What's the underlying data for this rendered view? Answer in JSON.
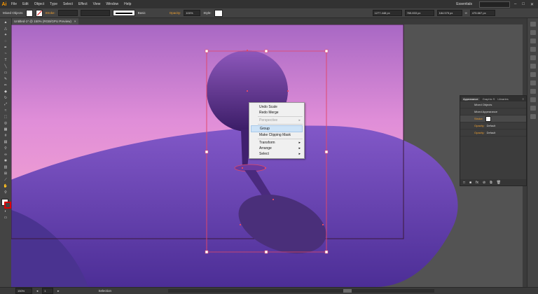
{
  "app": {
    "logo": "Ai"
  },
  "menu": [
    "File",
    "Edit",
    "Object",
    "Type",
    "Select",
    "Effect",
    "View",
    "Window",
    "Help"
  ],
  "workspace": "Essentials",
  "controlbar": {
    "selection_label": "Mixed Objects",
    "stroke_label": "Stroke:",
    "stroke_style": "Basic",
    "opacity_label": "Opacity:",
    "opacity_value": "100%",
    "style_label": "Style:",
    "x_value": "1277.448 px",
    "y_value": "765.833 px",
    "w_value": "184.575 px",
    "h_value": "475.667 px"
  },
  "document_tab": {
    "title": "Untitled-1* @ 150% (RGB/GPU Preview)",
    "close": "×"
  },
  "context_menu": [
    {
      "label": "Undo Scale",
      "enabled": true
    },
    {
      "label": "Redo Merge",
      "enabled": true
    },
    {
      "sep": true
    },
    {
      "label": "Perspective",
      "enabled": false,
      "submenu": true
    },
    {
      "sep": true
    },
    {
      "label": "Group",
      "enabled": true,
      "highlighted": true
    },
    {
      "label": "Make Clipping Mask",
      "enabled": true
    },
    {
      "sep": true
    },
    {
      "label": "Transform",
      "enabled": true,
      "submenu": true
    },
    {
      "label": "Arrange",
      "enabled": true,
      "submenu": true
    },
    {
      "label": "Select",
      "enabled": true,
      "submenu": true
    }
  ],
  "appearance_panel": {
    "tabs": [
      "Appearance",
      "Graphic S",
      "Libraries"
    ],
    "title": "Mixed Objects",
    "subtitle": "Mixed Appearance",
    "stroke_label": "Stroke:",
    "rows": [
      {
        "label": "Opacity:",
        "value": "Default"
      },
      {
        "label": "Opacity:",
        "value": "Default"
      }
    ]
  },
  "statusbar": {
    "zoom": "150%",
    "page": "1",
    "tool": "Selection"
  },
  "colors": {
    "sky_top": "#b070c8",
    "sky_mid": "#e090d8",
    "sky_bottom": "#f0a0d0",
    "hill": "#7a52c0",
    "hill_dark": "#5c3aa8",
    "figure_top": "#8a55b8",
    "figure_bottom": "#3c1f6a",
    "selection": "#e0486a"
  }
}
